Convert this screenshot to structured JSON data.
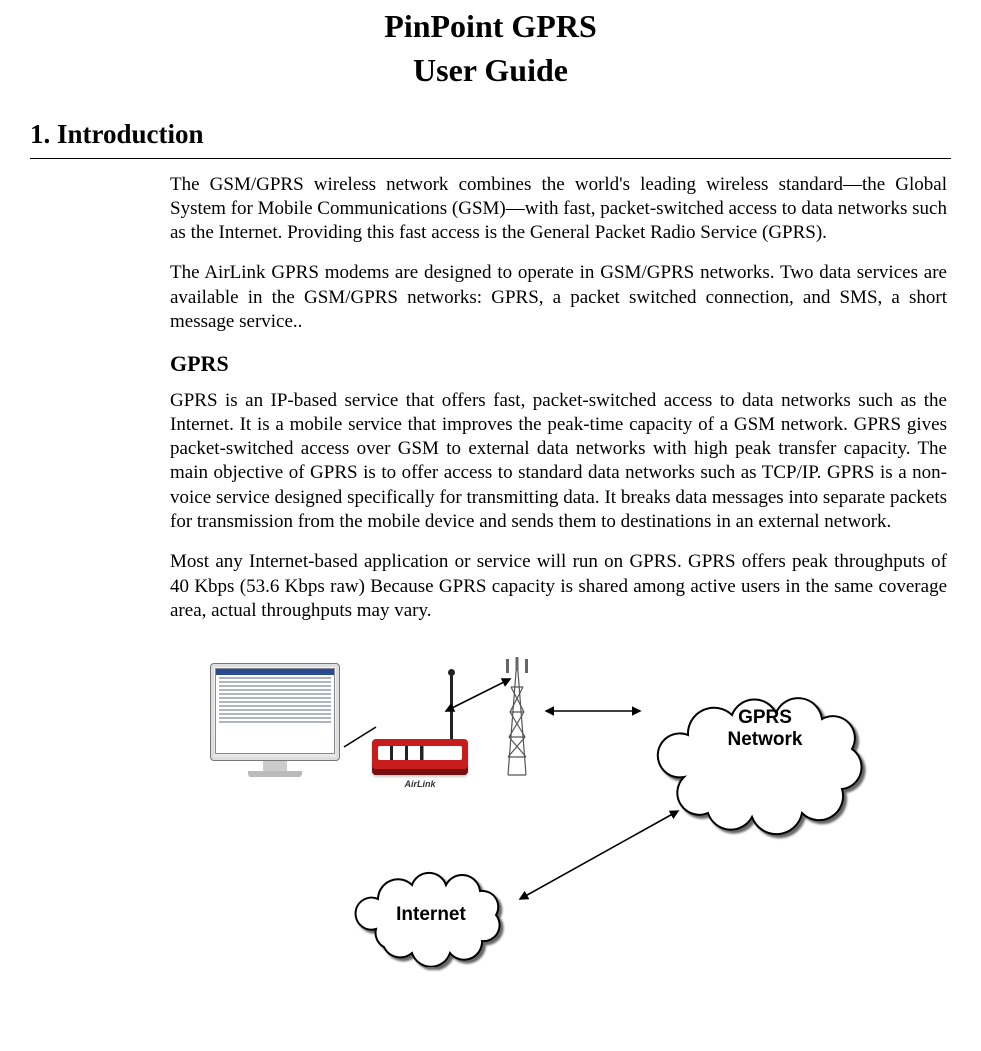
{
  "title_line1": "PinPoint GPRS",
  "title_line2": "User Guide",
  "section": {
    "number": "1.",
    "name": "Introduction"
  },
  "paragraphs": {
    "p1": "The GSM/GPRS wireless network combines the world's leading wireless standard—the Global System for Mobile Communications (GSM)—with fast, packet-switched access to data networks such as the Internet. Providing this fast access is the General Packet Radio Service (GPRS).",
    "p2": "The AirLink GPRS modems are designed to operate in GSM/GPRS networks. Two data services are available in the GSM/GPRS networks: GPRS, a packet switched connection, and SMS, a short message service..",
    "subhead": "GPRS",
    "p3": "GPRS is an IP-based service that offers fast, packet-switched access to data networks such as the Internet. It is a mobile service that improves the peak-time capacity of a GSM network. GPRS gives packet-switched access over GSM to external data networks with high peak transfer capacity. The main objective of GPRS is to offer access to standard data networks such as TCP/IP. GPRS is a non-voice service designed specifically for transmitting data. It breaks data messages into separate packets for transmission from the mobile device and sends them to destinations in an external network.",
    "p4": "Most any Internet-based application or service will run on GPRS. GPRS offers peak throughputs of 40 Kbps (53.6 Kbps raw) Because GPRS capacity is shared among active users in the same coverage area, actual throughputs may vary."
  },
  "figure": {
    "gprs_label": "GPRS Network",
    "internet_label": "Internet",
    "modem_brand": "AirLink"
  }
}
